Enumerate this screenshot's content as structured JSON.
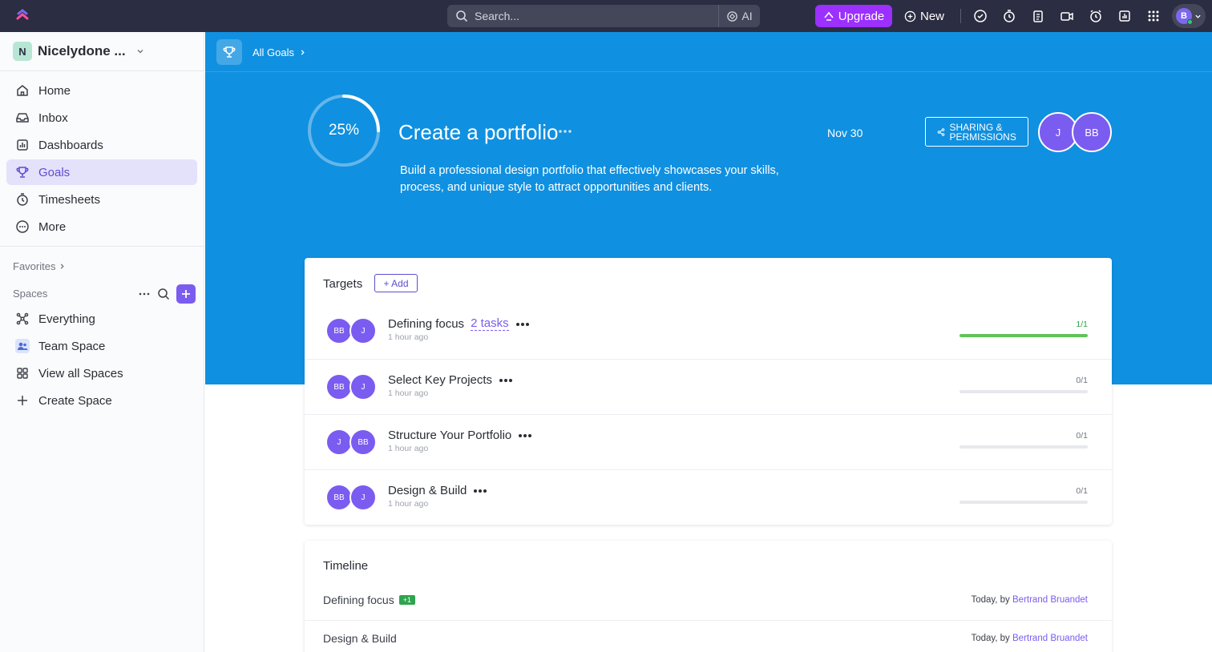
{
  "topbar": {
    "search_placeholder": "Search...",
    "ai_label": "AI",
    "upgrade_label": "Upgrade",
    "new_label": "New",
    "user_initial": "B"
  },
  "sidebar": {
    "workspace_initial": "N",
    "workspace_name": "Nicelydone ...",
    "nav": [
      {
        "label": "Home",
        "icon": "home-icon"
      },
      {
        "label": "Inbox",
        "icon": "inbox-icon"
      },
      {
        "label": "Dashboards",
        "icon": "dashboards-icon"
      },
      {
        "label": "Goals",
        "icon": "trophy-icon",
        "active": true
      },
      {
        "label": "Timesheets",
        "icon": "timesheets-icon"
      },
      {
        "label": "More",
        "icon": "more-icon"
      }
    ],
    "favorites_label": "Favorites",
    "spaces_label": "Spaces",
    "spaces": [
      {
        "label": "Everything",
        "icon": "everything-icon"
      },
      {
        "label": "Team Space",
        "icon": "team-icon"
      },
      {
        "label": "View all Spaces",
        "icon": "grid-icon"
      },
      {
        "label": "Create Space",
        "icon": "plus-icon"
      }
    ]
  },
  "breadcrumb": {
    "label": "All Goals"
  },
  "goal": {
    "progress_label": "25%",
    "progress": 0.25,
    "title": "Create a portfolio",
    "due_date": "Nov 30",
    "share_label": "SHARING & PERMISSIONS",
    "owners": [
      "J",
      "BB"
    ],
    "description": "Build a professional design portfolio that effectively showcases your skills, process, and unique style to attract opportunities and clients."
  },
  "targets": {
    "title": "Targets",
    "add_label": "+ Add",
    "items": [
      {
        "name": "Defining focus",
        "tasks": "2 tasks",
        "time": "1 hour ago",
        "progress_label": "1/1",
        "progress": 1,
        "avatars": [
          "BB",
          "J"
        ]
      },
      {
        "name": "Select Key Projects",
        "tasks": "",
        "time": "1 hour ago",
        "progress_label": "0/1",
        "progress": 0,
        "avatars": [
          "BB",
          "J"
        ]
      },
      {
        "name": "Structure Your Portfolio",
        "tasks": "",
        "time": "1 hour ago",
        "progress_label": "0/1",
        "progress": 0,
        "avatars": [
          "J",
          "BB"
        ]
      },
      {
        "name": "Design & Build",
        "tasks": "",
        "time": "1 hour ago",
        "progress_label": "0/1",
        "progress": 0,
        "avatars": [
          "BB",
          "J"
        ]
      }
    ]
  },
  "timeline": {
    "title": "Timeline",
    "items": [
      {
        "name": "Defining focus",
        "badge": "+1",
        "when": "Today, by",
        "who": "Bertrand Bruandet"
      },
      {
        "name": "Design & Build",
        "badge": "",
        "when": "Today, by",
        "who": "Bertrand Bruandet"
      }
    ]
  },
  "colors": {
    "accent": "#7b5cf0",
    "hero": "#1090e0",
    "topbar": "#2b2d42",
    "upgrade": "#9b30ff",
    "success": "#5ec456"
  }
}
